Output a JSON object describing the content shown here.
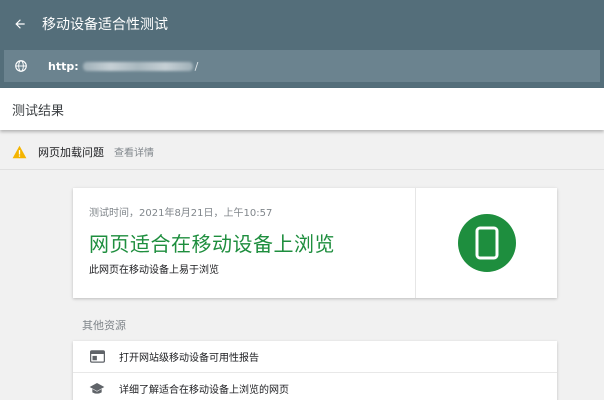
{
  "header": {
    "title": "移动设备适合性测试",
    "back_icon": "arrow-left-icon",
    "globe_icon": "globe-icon",
    "url_prefix": "http:",
    "url_suffix": "/"
  },
  "results_bar": {
    "title": "测试结果"
  },
  "issue": {
    "text": "网页加载问题",
    "link": "查看详情",
    "icon": "warning-icon",
    "icon_color": "#f4b400"
  },
  "result": {
    "test_time": "测试时间，2021年8月21日，上午10:57",
    "verdict": "网页适合在移动设备上浏览",
    "subtitle": "此网页在移动设备上易于浏览",
    "accent_color": "#1e8e3e",
    "icon": "smartphone-icon"
  },
  "resources": {
    "title": "其他资源",
    "items": [
      {
        "label": "打开网站级移动设备可用性报告",
        "icon": "web-report-icon"
      },
      {
        "label": "详细了解适合在移动设备上浏览的网页",
        "icon": "school-icon"
      }
    ]
  }
}
